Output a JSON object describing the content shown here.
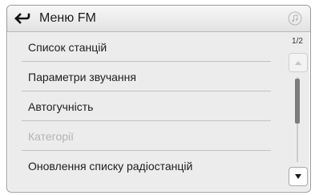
{
  "header": {
    "title": "Меню FM",
    "back_icon": "back-arrow-icon",
    "audio_icon": "music-note-icon"
  },
  "menu": {
    "items": [
      {
        "label": "Список станцій",
        "enabled": true
      },
      {
        "label": "Параметри звучання",
        "enabled": true
      },
      {
        "label": "Автогучність",
        "enabled": true
      },
      {
        "label": "Категорії",
        "enabled": false
      },
      {
        "label": "Оновлення списку радіостанцій",
        "enabled": true
      }
    ]
  },
  "scrollbar": {
    "page_indicator": "1/2",
    "up_icon": "chevron-up-icon",
    "down_icon": "chevron-down-icon"
  },
  "colors": {
    "background": "#ececec",
    "text": "#1e1e1e",
    "disabled_text": "#b3b3b3",
    "separator": "#c2c2c2"
  }
}
